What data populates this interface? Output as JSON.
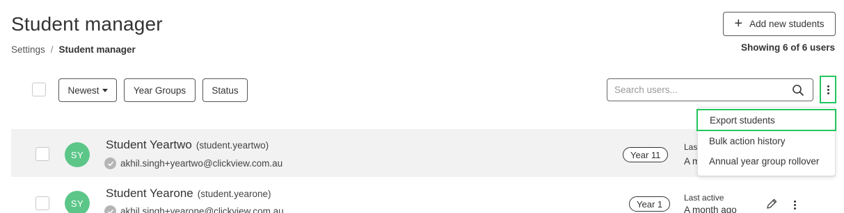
{
  "header": {
    "title": "Student manager",
    "breadcrumb": {
      "parent": "Settings",
      "separator": "/",
      "current": "Student manager"
    },
    "add_button_label": "Add new students",
    "showing_text": "Showing 6 of 6 users"
  },
  "toolbar": {
    "sort_label": "Newest",
    "year_groups_label": "Year Groups",
    "status_label": "Status",
    "search_placeholder": "Search users..."
  },
  "menu": {
    "items": [
      "Export students",
      "Bulk action history",
      "Annual year group rollover"
    ],
    "highlight_color": "#22c55e"
  },
  "students": [
    {
      "initials": "SY",
      "name": "Student Yeartwo",
      "username": "(student.yeartwo)",
      "email": "akhil.singh+yeartwo@clickview.com.au",
      "year": "Year 11",
      "last_active_label": "Last active",
      "last_active_value": "A month ago",
      "label_visible": "Last",
      "value_visible": "A m"
    },
    {
      "initials": "SY",
      "name": "Student Yearone",
      "username": "(student.yearone)",
      "email": "akhil.singh+yearone@clickview.com.au",
      "year": "Year 1",
      "last_active_label": "Last active",
      "last_active_value": "A month ago"
    }
  ],
  "colors": {
    "avatar": "#5cc689",
    "row_highlight": "#f2f2f2",
    "outline": "#22c55e"
  }
}
